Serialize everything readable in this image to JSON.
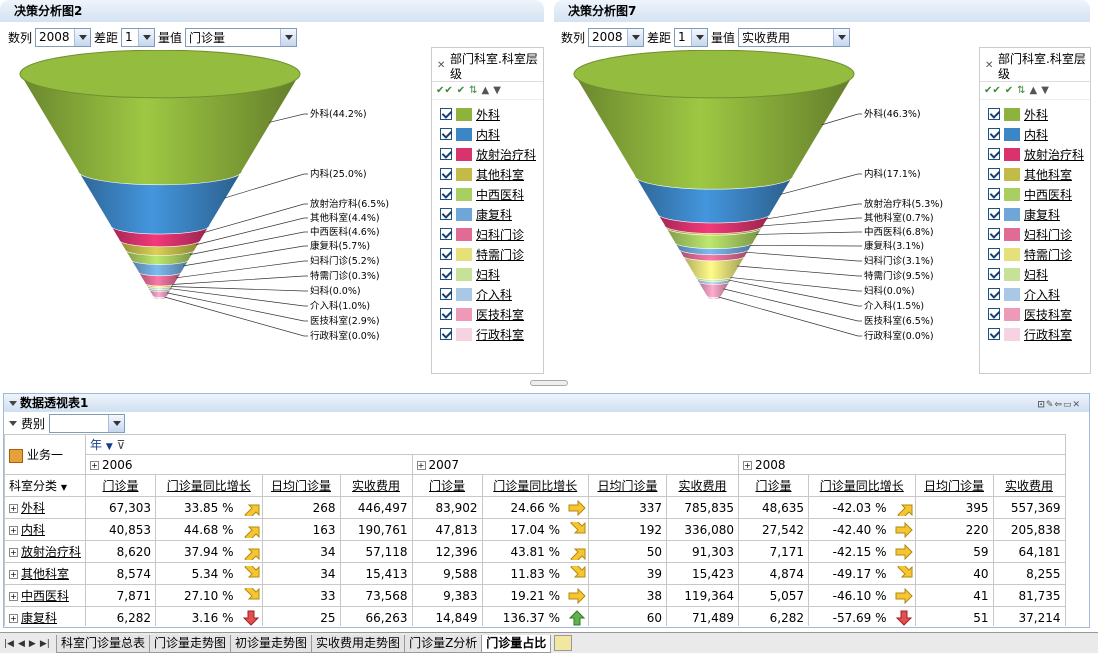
{
  "left_panel": {
    "title": "决策分析图2",
    "ctrl": {
      "series_label": "数列",
      "series_value": "2008",
      "diff_label": "差距",
      "diff_value": "1",
      "measure_label": "量值",
      "measure_value": "门诊量"
    },
    "labels": [
      "外科(44.2%)",
      "内科(25.0%)",
      "放射治疗科(6.5%)",
      "其他科室(4.4%)",
      "中西医科(4.6%)",
      "康复科(5.7%)",
      "妇科门诊(5.2%)",
      "特需门诊(0.3%)",
      "妇科(0.0%)",
      "介入科(1.0%)",
      "医技科室(2.9%)",
      "行政科室(0.0%)"
    ]
  },
  "right_panel": {
    "title": "决策分析图7",
    "ctrl": {
      "series_label": "数列",
      "series_value": "2008",
      "diff_label": "差距",
      "diff_value": "1",
      "measure_label": "量值",
      "measure_value": "实收费用"
    },
    "labels": [
      "外科(46.3%)",
      "内科(17.1%)",
      "放射治疗科(5.3%)",
      "其他科室(0.7%)",
      "中西医科(6.8%)",
      "康复科(3.1%)",
      "妇科门诊(3.1%)",
      "特需门诊(9.5%)",
      "妇科(0.0%)",
      "介入科(1.5%)",
      "医技科室(6.5%)",
      "行政科室(0.0%)"
    ]
  },
  "legend": {
    "title": "部门科室.科室层级",
    "items": [
      {
        "label": "外科",
        "color": "#8db33c"
      },
      {
        "label": "内科",
        "color": "#3d86c6"
      },
      {
        "label": "放射治疗科",
        "color": "#d9336e"
      },
      {
        "label": "其他科室",
        "color": "#c2bb4a"
      },
      {
        "label": "中西医科",
        "color": "#a9cf62"
      },
      {
        "label": "康复科",
        "color": "#6fa6d8"
      },
      {
        "label": "妇科门诊",
        "color": "#e06b95"
      },
      {
        "label": "特需门诊",
        "color": "#e6e07a"
      },
      {
        "label": "妇科",
        "color": "#c6e298"
      },
      {
        "label": "介入科",
        "color": "#a9c8e6"
      },
      {
        "label": "医技科室",
        "color": "#ec9ab8"
      },
      {
        "label": "行政科室",
        "color": "#f5d3e2"
      }
    ]
  },
  "pivot": {
    "title": "数据透视表1",
    "filter_label": "费别",
    "col_dim": "年",
    "row_dim": "业务一",
    "row_header": "科室分类",
    "years": [
      "2006",
      "2007",
      "2008"
    ],
    "measures": [
      "门诊量",
      "门诊量同比增长",
      "日均门诊量",
      "实收费用"
    ],
    "rows": [
      {
        "name": "外科",
        "v": [
          [
            "67,303",
            "33.85 %",
            "up-right",
            "268",
            "446,497"
          ],
          [
            "83,902",
            "24.66 %",
            "right",
            "337",
            "785,835"
          ],
          [
            "48,635",
            "-42.03 %",
            "up-right",
            "395",
            "557,369"
          ]
        ]
      },
      {
        "name": "内科",
        "v": [
          [
            "40,853",
            "44.68 %",
            "up-right",
            "163",
            "190,761"
          ],
          [
            "47,813",
            "17.04 %",
            "down-right",
            "192",
            "336,080"
          ],
          [
            "27,542",
            "-42.40 %",
            "right",
            "220",
            "205,838"
          ]
        ]
      },
      {
        "name": "放射治疗科",
        "v": [
          [
            "8,620",
            "37.94 %",
            "up-right",
            "34",
            "57,118"
          ],
          [
            "12,396",
            "43.81 %",
            "up-right",
            "50",
            "91,303"
          ],
          [
            "7,171",
            "-42.15 %",
            "right",
            "59",
            "64,181"
          ]
        ]
      },
      {
        "name": "其他科室",
        "v": [
          [
            "8,574",
            "5.34 %",
            "down-right",
            "34",
            "15,413"
          ],
          [
            "9,588",
            "11.83 %",
            "down-right",
            "39",
            "15,423"
          ],
          [
            "4,874",
            "-49.17 %",
            "down-right",
            "40",
            "8,255"
          ]
        ]
      },
      {
        "name": "中西医科",
        "v": [
          [
            "7,871",
            "27.10 %",
            "down-right",
            "33",
            "73,568"
          ],
          [
            "9,383",
            "19.21 %",
            "right",
            "38",
            "119,364"
          ],
          [
            "5,057",
            "-46.10 %",
            "right",
            "41",
            "81,735"
          ]
        ]
      },
      {
        "name": "康复科",
        "v": [
          [
            "6,282",
            "3.16 %",
            "down",
            "25",
            "66,263"
          ],
          [
            "14,849",
            "136.37 %",
            "up",
            "60",
            "71,489"
          ],
          [
            "6,282",
            "-57.69 %",
            "down",
            "51",
            "37,214"
          ]
        ]
      }
    ]
  },
  "tabs": [
    "科室门诊量总表",
    "门诊量走势图",
    "初诊量走势图",
    "实收费用走势图",
    "门诊量Z分析",
    "门诊量占比"
  ],
  "active_tab": "门诊量占比"
}
